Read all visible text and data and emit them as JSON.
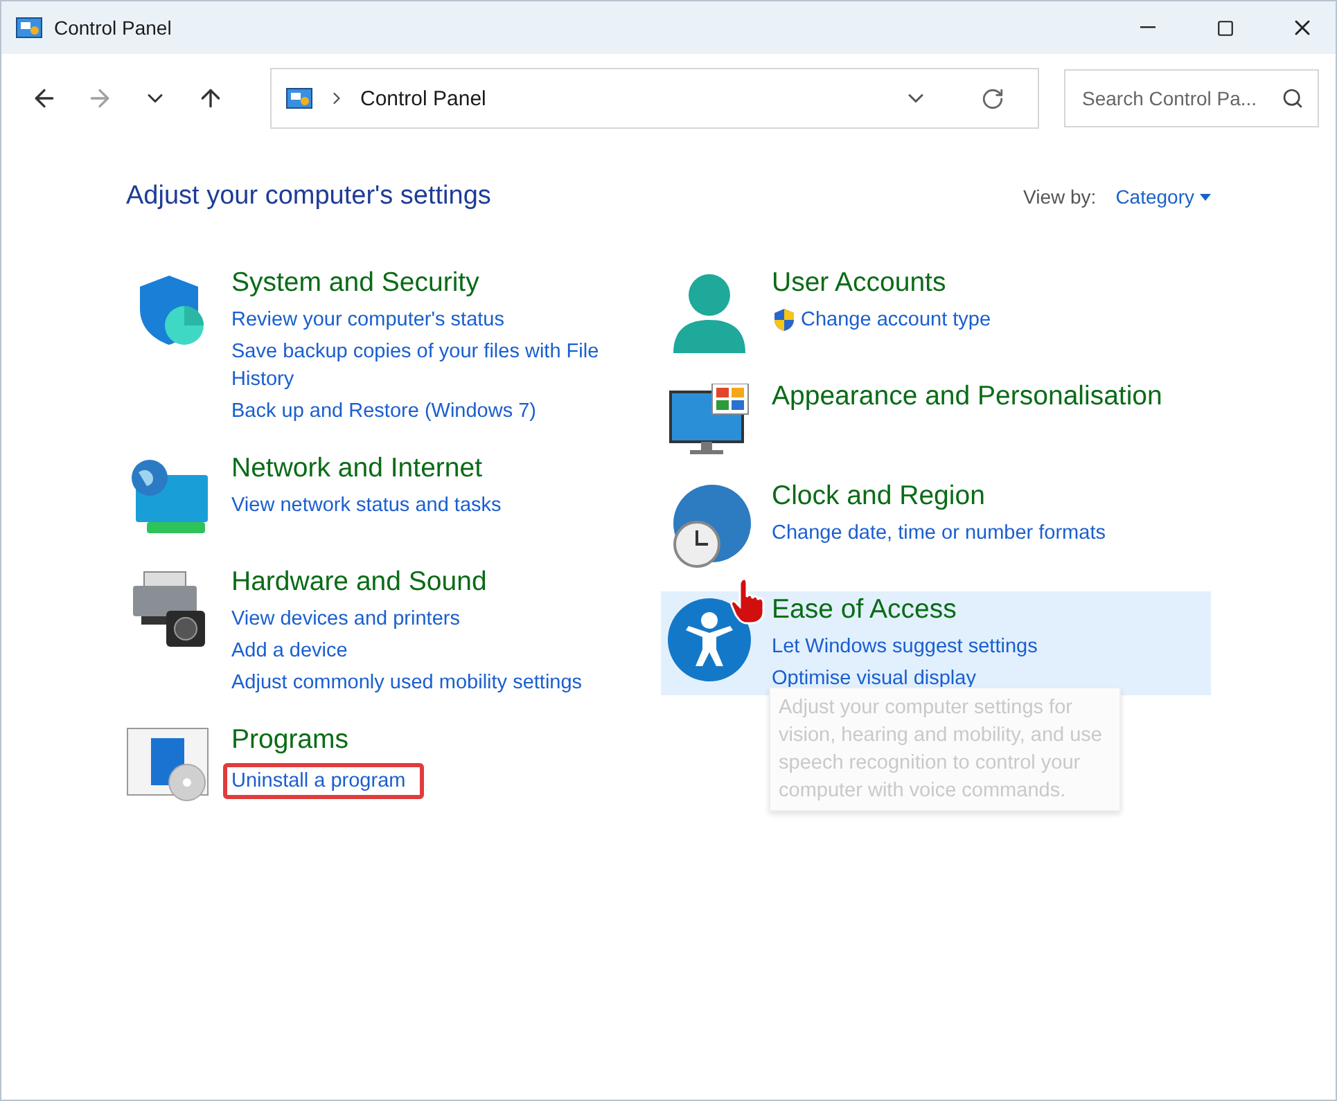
{
  "window": {
    "title": "Control Panel"
  },
  "address_bar": {
    "path": "Control Panel"
  },
  "search": {
    "placeholder": "Search Control Pa..."
  },
  "heading": "Adjust your computer's settings",
  "view_by": {
    "label": "View by:",
    "value": "Category"
  },
  "left_categories": [
    {
      "title": "System and Security",
      "hovered": false,
      "links": [
        {
          "text": "Review your computer's status",
          "shield": false,
          "highlighted": false
        },
        {
          "text": "Save backup copies of your files with File History",
          "shield": false,
          "highlighted": false
        },
        {
          "text": "Back up and Restore (Windows 7)",
          "shield": false,
          "highlighted": false
        }
      ]
    },
    {
      "title": "Network and Internet",
      "hovered": false,
      "links": [
        {
          "text": "View network status and tasks",
          "shield": false,
          "highlighted": false
        }
      ]
    },
    {
      "title": "Hardware and Sound",
      "hovered": false,
      "links": [
        {
          "text": "View devices and printers",
          "shield": false,
          "highlighted": false
        },
        {
          "text": "Add a device",
          "shield": false,
          "highlighted": false
        },
        {
          "text": "Adjust commonly used mobility settings",
          "shield": false,
          "highlighted": false
        }
      ]
    },
    {
      "title": "Programs",
      "hovered": false,
      "links": [
        {
          "text": "Uninstall a program",
          "shield": false,
          "highlighted": true
        }
      ]
    }
  ],
  "right_categories": [
    {
      "title": "User Accounts",
      "hovered": false,
      "links": [
        {
          "text": "Change account type",
          "shield": true,
          "highlighted": false
        }
      ]
    },
    {
      "title": "Appearance and Personalisation",
      "hovered": false
    },
    {
      "title": "Clock and Region",
      "hovered": false,
      "links": [
        {
          "text": "Change date, time or number formats",
          "shield": false,
          "highlighted": false
        }
      ]
    },
    {
      "title": "Ease of Access",
      "hovered": true,
      "links": [
        {
          "text": "Let Windows suggest settings",
          "shield": false,
          "highlighted": false
        },
        {
          "text": "Optimise visual display",
          "shield": false,
          "highlighted": false
        }
      ],
      "tooltip": "Adjust your computer settings for vision, hearing and mobility, and use speech recognition to control your computer with voice commands."
    }
  ]
}
